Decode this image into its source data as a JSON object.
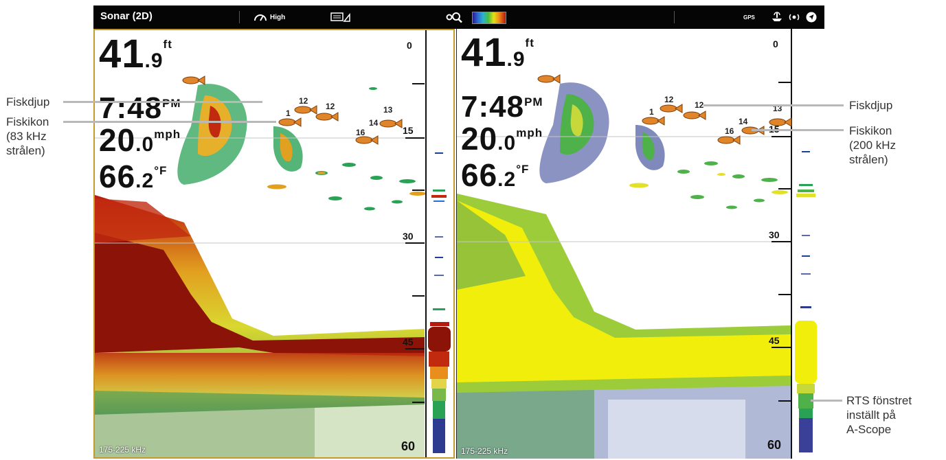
{
  "topbar": {
    "title": "Sonar (2D)",
    "sensitivity_label": "High",
    "icons": [
      "speed-dial-icon",
      "sonar-screen-icon",
      "color-palette-icon",
      "zoom-settings-icon",
      "gps-icon",
      "boat-icon",
      "sonar-status-icon",
      "navigation-icon"
    ],
    "gps_label": "GPS"
  },
  "panels": {
    "left": {
      "depth_whole": "41",
      "depth_decimal": ".9",
      "depth_unit": "ft",
      "time": "7:48",
      "time_suffix": "PM",
      "speed_whole": "20",
      "speed_decimal": ".0",
      "speed_unit": "mph",
      "temp_whole": "66",
      "temp_decimal": ".2",
      "temp_unit": "°F",
      "frequency": "175-225 kHz",
      "depth_scale": [
        "0",
        "15",
        "30",
        "45",
        "60"
      ],
      "fish_depths": [
        "12",
        "12",
        "1",
        "13",
        "14",
        "16"
      ]
    },
    "right": {
      "depth_whole": "41",
      "depth_decimal": ".9",
      "depth_unit": "ft",
      "time": "7:48",
      "time_suffix": "PM",
      "speed_whole": "20",
      "speed_decimal": ".0",
      "speed_unit": "mph",
      "temp_whole": "66",
      "temp_decimal": ".2",
      "temp_unit": "°F",
      "frequency": "175-225 kHz",
      "depth_scale": [
        "0",
        "15",
        "30",
        "45",
        "60"
      ],
      "fish_depths": [
        "12",
        "12",
        "1",
        "13",
        "14",
        "16"
      ]
    }
  },
  "annotations": {
    "left_fish_depth": "Fiskdjup",
    "left_fish_icon_1": "Fiskikon",
    "left_fish_icon_2": "(83 kHz",
    "left_fish_icon_3": "strålen)",
    "right_fish_depth": "Fiskdjup",
    "right_fish_icon_1": "Fiskikon",
    "right_fish_icon_2": "(200 kHz",
    "right_fish_icon_3": "strålen)",
    "rts_1": "RTS fönstret",
    "rts_2": "inställt på",
    "rts_3": "A-Scope"
  },
  "colors": {
    "panel_border_active": "#c59a2a",
    "bottom_left": "#8b1308",
    "bottom_right": "#f2ee0c",
    "fish_icon": "#e0852a",
    "topbar": "#050505"
  }
}
